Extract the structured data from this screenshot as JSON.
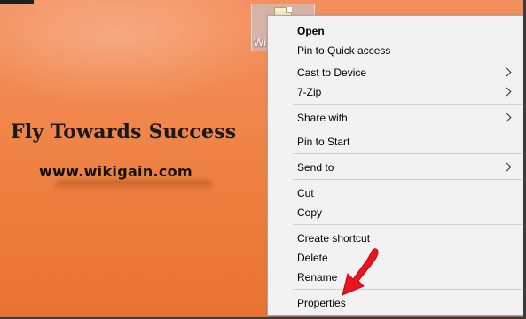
{
  "desktop": {
    "file_label": "Wi",
    "headline": "Fly Towards Success",
    "website": "www.wikigain.com"
  },
  "context_menu": {
    "items": [
      {
        "label": "Open",
        "bold": true,
        "submenu": false
      },
      {
        "label": "Pin to Quick access",
        "bold": false,
        "submenu": false
      },
      {
        "label": "Cast to Device",
        "bold": false,
        "submenu": true
      },
      {
        "label": "7-Zip",
        "bold": false,
        "submenu": true
      },
      {
        "label": "Share with",
        "bold": false,
        "submenu": true
      },
      {
        "label": "Pin to Start",
        "bold": false,
        "submenu": false
      },
      {
        "label": "Send to",
        "bold": false,
        "submenu": true
      },
      {
        "label": "Cut",
        "bold": false,
        "submenu": false
      },
      {
        "label": "Copy",
        "bold": false,
        "submenu": false
      },
      {
        "label": "Create shortcut",
        "bold": false,
        "submenu": false
      },
      {
        "label": "Delete",
        "bold": false,
        "submenu": false
      },
      {
        "label": "Rename",
        "bold": false,
        "submenu": false
      },
      {
        "label": "Properties",
        "bold": false,
        "submenu": false
      }
    ]
  },
  "colors": {
    "background": "#ec7a38",
    "menu_background": "#f2f2f2",
    "annotation_arrow": "#e8141e"
  },
  "icons": {
    "file": "document-icon",
    "submenu": "chevron-right-icon",
    "annotation": "red-arrow-icon"
  }
}
